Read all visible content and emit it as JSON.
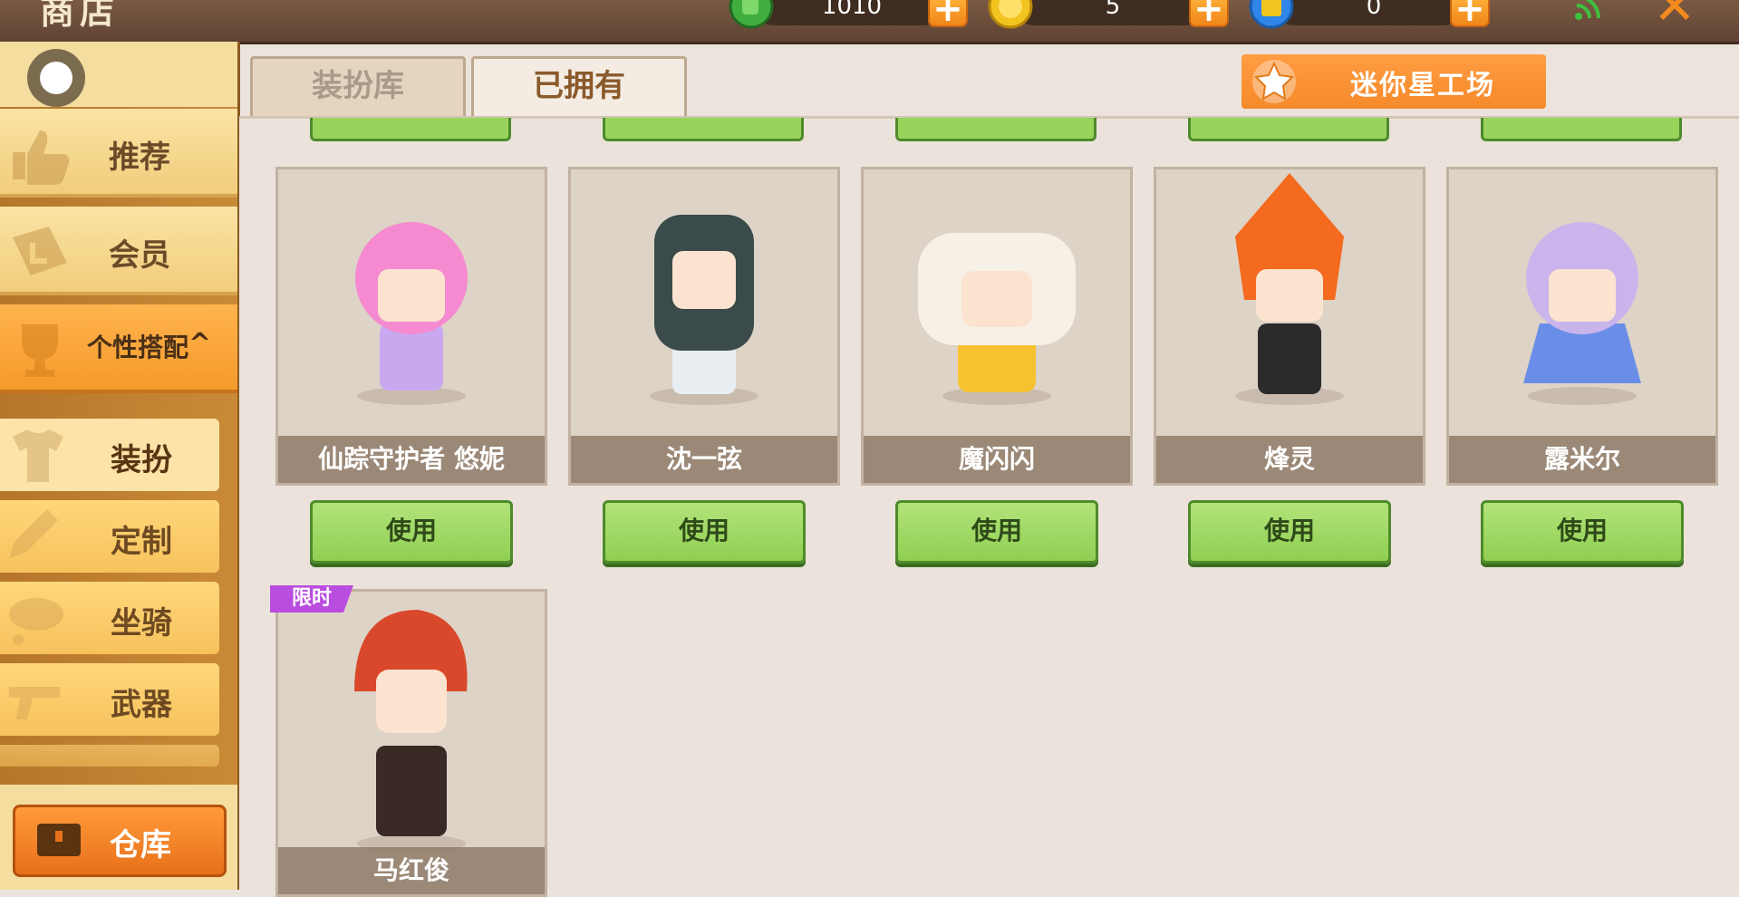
{
  "header": {
    "title": "商店",
    "currencies": [
      {
        "icon": "mini-bean-icon",
        "value": "1010",
        "color": "#3fae3f"
      },
      {
        "icon": "mini-coin-icon",
        "value": "5",
        "color": "#f2c41f"
      },
      {
        "icon": "star-coupon-icon",
        "value": "0",
        "color": "#2f86e8"
      }
    ]
  },
  "sidebar": {
    "categories": [
      {
        "label": "推荐",
        "icon": "thumbs-up-icon"
      },
      {
        "label": "会员",
        "icon": "vip-icon"
      },
      {
        "label": "个性搭配",
        "icon": "trophy-icon",
        "expand_glyph": "^"
      }
    ],
    "subitems": [
      {
        "label": "装扮",
        "icon": "shirt-icon"
      },
      {
        "label": "定制",
        "icon": "pencil-icon"
      },
      {
        "label": "坐骑",
        "icon": "mount-icon"
      },
      {
        "label": "武器",
        "icon": "gun-icon"
      }
    ],
    "warehouse_label": "仓库"
  },
  "tabs": [
    {
      "label": "装扮库"
    },
    {
      "label": "已拥有"
    }
  ],
  "workshop_label": "迷你星工场",
  "items": [
    {
      "name": "仙踪守护者 悠妮",
      "button": "使用",
      "hair": "#f58ad0",
      "outfit": "#c9a8f0"
    },
    {
      "name": "沈一弦",
      "button": "使用",
      "hair": "#3b4a4a",
      "outfit": "#e8eef2"
    },
    {
      "name": "魔闪闪",
      "button": "使用",
      "hair": "#f6f0e6",
      "outfit": "#f6c230"
    },
    {
      "name": "烽灵",
      "button": "使用",
      "hair": "#f46a1e",
      "outfit": "#2b2b2b"
    },
    {
      "name": "露米尔",
      "button": "使用",
      "hair": "#c9b5ec",
      "outfit": "#6a8ee8"
    },
    {
      "name": "马红俊",
      "badge": "限时",
      "hair": "#d9482a",
      "outfit": "#3a2a26"
    }
  ]
}
